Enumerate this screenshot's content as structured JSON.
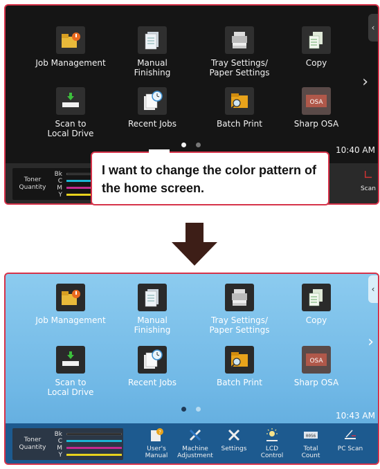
{
  "before": {
    "tiles_row1": [
      "Job Management",
      "Manual\nFinishing",
      "Tray Settings/\nPaper Settings",
      "Copy"
    ],
    "tiles_row2": [
      "Scan to\nLocal Drive",
      "Recent Jobs",
      "Batch Print",
      "Sharp OSA"
    ],
    "clock": "10:40 AM",
    "toner_label": "Toner\nQuantity",
    "toner_rows": [
      "Bk",
      "C",
      "M",
      "Y"
    ],
    "partial_item": "Scan"
  },
  "callout_text": "I want to change the color pattern of the home screen.",
  "after": {
    "tiles_row1": [
      "Job Management",
      "Manual\nFinishing",
      "Tray Settings/\nPaper Settings",
      "Copy"
    ],
    "tiles_row2": [
      "Scan to\nLocal Drive",
      "Recent Jobs",
      "Batch Print",
      "Sharp OSA"
    ],
    "clock": "10:43 AM",
    "toner_label": "Toner\nQuantity",
    "toner_rows": [
      "Bk",
      "C",
      "M",
      "Y"
    ],
    "status_items": [
      "User's\nManual",
      "Machine\nAdjustment",
      "Settings",
      "LCD\nControl",
      "Total\nCount",
      "PC Scan"
    ]
  },
  "colors": {
    "frame": "#d63249",
    "dark_bg": "#151515",
    "light_bg": "#7fc3ec",
    "toner_bk": "#000000",
    "toner_c": "#1bb5d6",
    "toner_m": "#c42a8e",
    "toner_y": "#e8d21d"
  },
  "icons": [
    "folder-alert-icon",
    "document-stack-icon",
    "tray-icon",
    "copy-icon",
    "scan-drive-icon",
    "recent-jobs-icon",
    "folder-search-icon",
    "osa-icon",
    "manual-icon",
    "machine-adjust-icon",
    "settings-icon",
    "lcd-control-icon",
    "total-count-icon",
    "pc-scan-icon"
  ]
}
